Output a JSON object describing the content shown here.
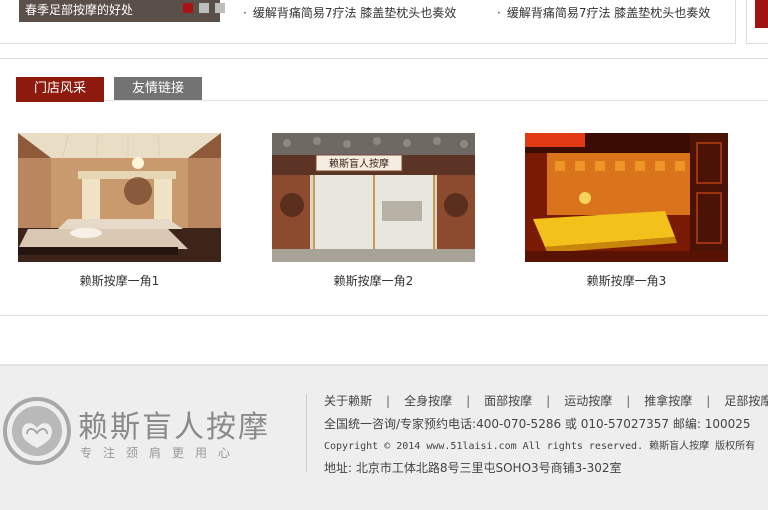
{
  "top_strip": {
    "slide_caption": "春季足部按摩的好处",
    "news": [
      {
        "bullet": "·",
        "text": "缓解背痛简易7疗法 膝盖垫枕头也奏效"
      },
      {
        "bullet": "·",
        "text": "缓解背痛简易7疗法 膝盖垫枕头也奏效"
      }
    ]
  },
  "tabs": [
    {
      "label": "门店风采",
      "active": true
    },
    {
      "label": "友情链接",
      "active": false
    }
  ],
  "gallery": [
    {
      "caption": "赖斯按摩一角1"
    },
    {
      "caption": "赖斯按摩一角2",
      "sign_text": "赖斯盲人按摩"
    },
    {
      "caption": "赖斯按摩一角3"
    }
  ],
  "footer": {
    "brand_name": "赖斯盲人按摩",
    "slogan": "专注颈肩更用心",
    "nav": [
      "关于赖斯",
      "全身按摩",
      "面部按摩",
      "运动按摩",
      "推拿按摩",
      "足部按摩"
    ],
    "nav_separator": "|",
    "contact_line": "全国统一咨询/专家预约电话:400-070-5286 或 010-57027357 邮编: 100025",
    "copyright_line": "Copyright © 2014 www.51laisi.com All rights reserved. 赖斯盲人按摩 版权所有",
    "address_line": "地址: 北京市工体北路8号三里屯SOHO3号商铺3-302室"
  },
  "colors": {
    "accent_red": "#8e1a0e",
    "tab_gray": "#737373",
    "footer_bg": "#eeeeee"
  }
}
